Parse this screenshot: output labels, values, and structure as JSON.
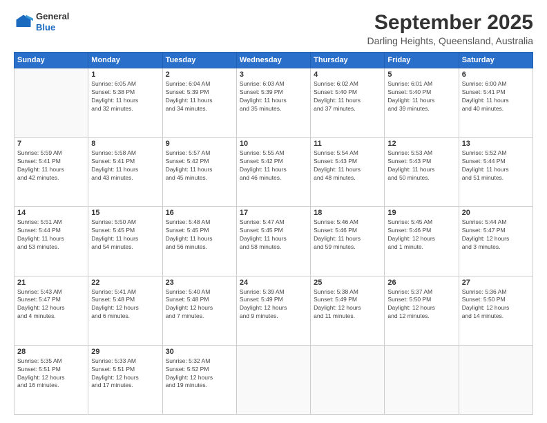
{
  "header": {
    "logo": {
      "general": "General",
      "blue": "Blue"
    },
    "month": "September 2025",
    "location": "Darling Heights, Queensland, Australia"
  },
  "days_of_week": [
    "Sunday",
    "Monday",
    "Tuesday",
    "Wednesday",
    "Thursday",
    "Friday",
    "Saturday"
  ],
  "weeks": [
    [
      {
        "day": "",
        "sunrise": "",
        "sunset": "",
        "daylight": ""
      },
      {
        "day": "1",
        "sunrise": "Sunrise: 6:05 AM",
        "sunset": "Sunset: 5:38 PM",
        "daylight": "Daylight: 11 hours and 32 minutes."
      },
      {
        "day": "2",
        "sunrise": "Sunrise: 6:04 AM",
        "sunset": "Sunset: 5:39 PM",
        "daylight": "Daylight: 11 hours and 34 minutes."
      },
      {
        "day": "3",
        "sunrise": "Sunrise: 6:03 AM",
        "sunset": "Sunset: 5:39 PM",
        "daylight": "Daylight: 11 hours and 35 minutes."
      },
      {
        "day": "4",
        "sunrise": "Sunrise: 6:02 AM",
        "sunset": "Sunset: 5:40 PM",
        "daylight": "Daylight: 11 hours and 37 minutes."
      },
      {
        "day": "5",
        "sunrise": "Sunrise: 6:01 AM",
        "sunset": "Sunset: 5:40 PM",
        "daylight": "Daylight: 11 hours and 39 minutes."
      },
      {
        "day": "6",
        "sunrise": "Sunrise: 6:00 AM",
        "sunset": "Sunset: 5:41 PM",
        "daylight": "Daylight: 11 hours and 40 minutes."
      }
    ],
    [
      {
        "day": "7",
        "sunrise": "Sunrise: 5:59 AM",
        "sunset": "Sunset: 5:41 PM",
        "daylight": "Daylight: 11 hours and 42 minutes."
      },
      {
        "day": "8",
        "sunrise": "Sunrise: 5:58 AM",
        "sunset": "Sunset: 5:41 PM",
        "daylight": "Daylight: 11 hours and 43 minutes."
      },
      {
        "day": "9",
        "sunrise": "Sunrise: 5:57 AM",
        "sunset": "Sunset: 5:42 PM",
        "daylight": "Daylight: 11 hours and 45 minutes."
      },
      {
        "day": "10",
        "sunrise": "Sunrise: 5:55 AM",
        "sunset": "Sunset: 5:42 PM",
        "daylight": "Daylight: 11 hours and 46 minutes."
      },
      {
        "day": "11",
        "sunrise": "Sunrise: 5:54 AM",
        "sunset": "Sunset: 5:43 PM",
        "daylight": "Daylight: 11 hours and 48 minutes."
      },
      {
        "day": "12",
        "sunrise": "Sunrise: 5:53 AM",
        "sunset": "Sunset: 5:43 PM",
        "daylight": "Daylight: 11 hours and 50 minutes."
      },
      {
        "day": "13",
        "sunrise": "Sunrise: 5:52 AM",
        "sunset": "Sunset: 5:44 PM",
        "daylight": "Daylight: 11 hours and 51 minutes."
      }
    ],
    [
      {
        "day": "14",
        "sunrise": "Sunrise: 5:51 AM",
        "sunset": "Sunset: 5:44 PM",
        "daylight": "Daylight: 11 hours and 53 minutes."
      },
      {
        "day": "15",
        "sunrise": "Sunrise: 5:50 AM",
        "sunset": "Sunset: 5:45 PM",
        "daylight": "Daylight: 11 hours and 54 minutes."
      },
      {
        "day": "16",
        "sunrise": "Sunrise: 5:48 AM",
        "sunset": "Sunset: 5:45 PM",
        "daylight": "Daylight: 11 hours and 56 minutes."
      },
      {
        "day": "17",
        "sunrise": "Sunrise: 5:47 AM",
        "sunset": "Sunset: 5:45 PM",
        "daylight": "Daylight: 11 hours and 58 minutes."
      },
      {
        "day": "18",
        "sunrise": "Sunrise: 5:46 AM",
        "sunset": "Sunset: 5:46 PM",
        "daylight": "Daylight: 11 hours and 59 minutes."
      },
      {
        "day": "19",
        "sunrise": "Sunrise: 5:45 AM",
        "sunset": "Sunset: 5:46 PM",
        "daylight": "Daylight: 12 hours and 1 minute."
      },
      {
        "day": "20",
        "sunrise": "Sunrise: 5:44 AM",
        "sunset": "Sunset: 5:47 PM",
        "daylight": "Daylight: 12 hours and 3 minutes."
      }
    ],
    [
      {
        "day": "21",
        "sunrise": "Sunrise: 5:43 AM",
        "sunset": "Sunset: 5:47 PM",
        "daylight": "Daylight: 12 hours and 4 minutes."
      },
      {
        "day": "22",
        "sunrise": "Sunrise: 5:41 AM",
        "sunset": "Sunset: 5:48 PM",
        "daylight": "Daylight: 12 hours and 6 minutes."
      },
      {
        "day": "23",
        "sunrise": "Sunrise: 5:40 AM",
        "sunset": "Sunset: 5:48 PM",
        "daylight": "Daylight: 12 hours and 7 minutes."
      },
      {
        "day": "24",
        "sunrise": "Sunrise: 5:39 AM",
        "sunset": "Sunset: 5:49 PM",
        "daylight": "Daylight: 12 hours and 9 minutes."
      },
      {
        "day": "25",
        "sunrise": "Sunrise: 5:38 AM",
        "sunset": "Sunset: 5:49 PM",
        "daylight": "Daylight: 12 hours and 11 minutes."
      },
      {
        "day": "26",
        "sunrise": "Sunrise: 5:37 AM",
        "sunset": "Sunset: 5:50 PM",
        "daylight": "Daylight: 12 hours and 12 minutes."
      },
      {
        "day": "27",
        "sunrise": "Sunrise: 5:36 AM",
        "sunset": "Sunset: 5:50 PM",
        "daylight": "Daylight: 12 hours and 14 minutes."
      }
    ],
    [
      {
        "day": "28",
        "sunrise": "Sunrise: 5:35 AM",
        "sunset": "Sunset: 5:51 PM",
        "daylight": "Daylight: 12 hours and 16 minutes."
      },
      {
        "day": "29",
        "sunrise": "Sunrise: 5:33 AM",
        "sunset": "Sunset: 5:51 PM",
        "daylight": "Daylight: 12 hours and 17 minutes."
      },
      {
        "day": "30",
        "sunrise": "Sunrise: 5:32 AM",
        "sunset": "Sunset: 5:52 PM",
        "daylight": "Daylight: 12 hours and 19 minutes."
      },
      {
        "day": "",
        "sunrise": "",
        "sunset": "",
        "daylight": ""
      },
      {
        "day": "",
        "sunrise": "",
        "sunset": "",
        "daylight": ""
      },
      {
        "day": "",
        "sunrise": "",
        "sunset": "",
        "daylight": ""
      },
      {
        "day": "",
        "sunrise": "",
        "sunset": "",
        "daylight": ""
      }
    ]
  ]
}
